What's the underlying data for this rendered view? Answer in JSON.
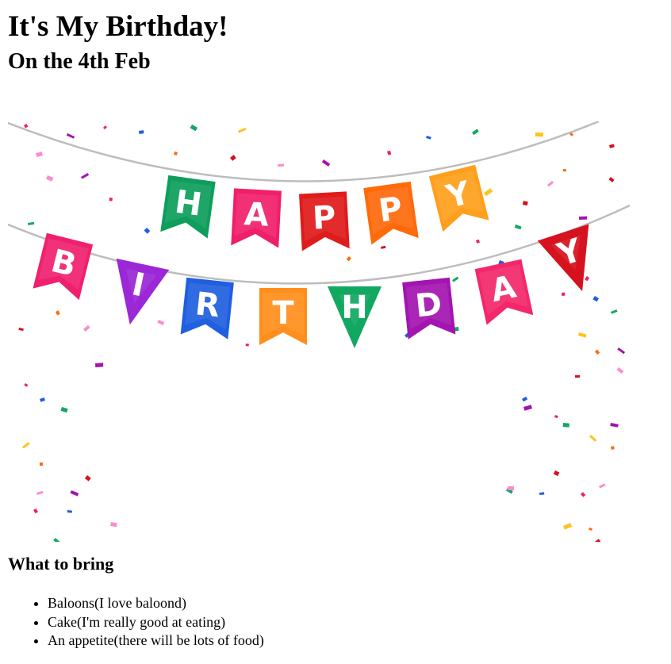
{
  "page": {
    "title": "It's My Birthday!",
    "subtitle": "On the 4th Feb"
  },
  "banner": {
    "row1_letters": [
      "H",
      "A",
      "P",
      "P",
      "Y"
    ],
    "row2_letters": [
      "B",
      "I",
      "R",
      "T",
      "H",
      "D",
      "A",
      "Y"
    ],
    "row1_colors": [
      "#0e9e5c",
      "#f01f6a",
      "#e01b1b",
      "#ff6a0a",
      "#ff9f1c"
    ],
    "row2_colors": [
      "#f0206e",
      "#9b27d6",
      "#1f5fe0",
      "#ff8f1c",
      "#12a861",
      "#a314b0",
      "#f3286a",
      "#d6121e"
    ]
  },
  "bring": {
    "heading": "What to bring",
    "items": [
      "Baloons(I love baloond)",
      "Cake(I'm really good at eating)",
      "An appetite(there will be lots of food)"
    ]
  }
}
